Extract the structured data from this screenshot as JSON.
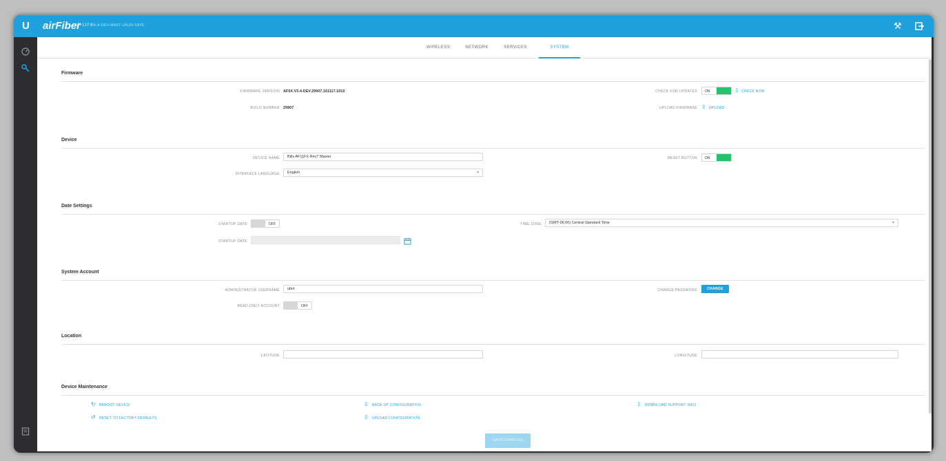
{
  "header": {
    "logo_letter": "U",
    "product": "airFiber",
    "model": "AF-11FX",
    "hostname": "PA-A-DEV-MAST-UAUN-SAYE"
  },
  "tabs": [
    {
      "label": "WIRELESS"
    },
    {
      "label": "NETWORK"
    },
    {
      "label": "SERVICES"
    },
    {
      "label": "SYSTEM"
    }
  ],
  "firmware": {
    "title": "Firmware",
    "version_label": "FIRMWARE VERSION",
    "version_value": "AF0X.V3.4-DEV.29907.161117.1010",
    "build_label": "BUILD NUMBER",
    "build_value": "29907",
    "check_label": "CHECK FOR UPDATES",
    "check_state": "ON",
    "check_now": "CHECK NOW",
    "upload_label": "UPLOAD FIRMWARE",
    "upload_link": "UPLOAD"
  },
  "device": {
    "title": "Device",
    "name_label": "DEVICE NAME",
    "name_value": "Bills AF11FX Rev7 Master",
    "language_label": "INTERFACE LANGUAGE",
    "language_value": "English",
    "reset_label": "RESET BUTTON",
    "reset_state": "ON"
  },
  "date": {
    "title": "Date Settings",
    "startup_toggle_label": "STARTUP DATE",
    "startup_state": "OFF",
    "startup_date_label": "STARTUP DATE",
    "startup_date_value": "",
    "timezone_label": "TIME ZONE",
    "timezone_value": "(GMT-06:00) Central Standard Time"
  },
  "account": {
    "title": "System Account",
    "username_label": "ADMINISTRATOR USERNAME",
    "username_value": "ubnt",
    "readonly_label": "READ-ONLY ACCOUNT",
    "readonly_state": "OFF",
    "password_label": "CHANGE PASSWORD",
    "change_button": "CHANGE"
  },
  "location": {
    "title": "Location",
    "latitude_label": "LATITUDE",
    "latitude_value": "",
    "longitude_label": "LONGITUDE",
    "longitude_value": ""
  },
  "maintenance": {
    "title": "Device Maintenance",
    "reboot": "REBOOT DEVICE",
    "reset_defaults": "RESET TO FACTORY DEFAULTS",
    "backup": "BACK UP CONFIGURATION",
    "upload_config": "UPLOAD CONFIGURATION",
    "support": "DOWNLOAD SUPPORT INFO"
  },
  "footer": {
    "save_button": "SAVE CHANGES"
  },
  "colors": {
    "accent": "#1ea1dc",
    "toggle_on": "#25c16f",
    "sidebar": "#2b2d30"
  }
}
